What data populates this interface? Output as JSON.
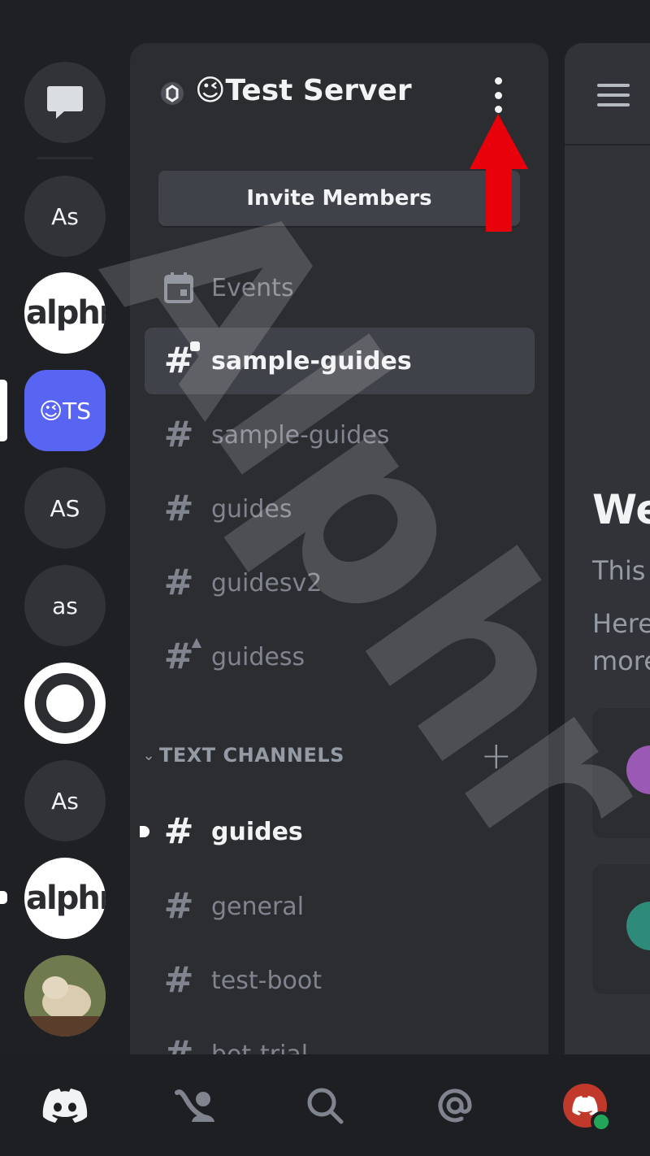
{
  "servers": [
    {
      "label": ""
    },
    {
      "label": "As"
    },
    {
      "label": "alphr"
    },
    {
      "label": "😉TS"
    },
    {
      "label": "AS"
    },
    {
      "label": "as"
    },
    {
      "label": ""
    },
    {
      "label": "As"
    },
    {
      "label": "alphr"
    },
    {
      "label": ""
    }
  ],
  "server": {
    "name": "😉Test Server",
    "invite_label": "Invite Members"
  },
  "channels": [
    {
      "label": "Events",
      "icon": "calendar-icon"
    },
    {
      "label": "sample-guides",
      "icon": "hash-lock-icon",
      "selected": true
    },
    {
      "label": "sample-guides",
      "icon": "hash-icon"
    },
    {
      "label": "guides",
      "icon": "hash-icon"
    },
    {
      "label": "guidesv2",
      "icon": "hash-icon"
    },
    {
      "label": "guidess",
      "icon": "hash-warning-icon"
    }
  ],
  "category": {
    "title": "TEXT CHANNELS",
    "plus": "+",
    "chevron": "⌄",
    "channels": [
      {
        "label": "guides",
        "unread": true
      },
      {
        "label": "general"
      },
      {
        "label": "test-boot"
      },
      {
        "label": "bot-trial"
      }
    ]
  },
  "peek": {
    "welcome": "We",
    "line1": "This",
    "line2": "Here",
    "line3": "more"
  },
  "watermark": "Alphr",
  "colors": {
    "accent": "#5865f2",
    "arrow": "#e8000b",
    "online": "#23a559"
  }
}
